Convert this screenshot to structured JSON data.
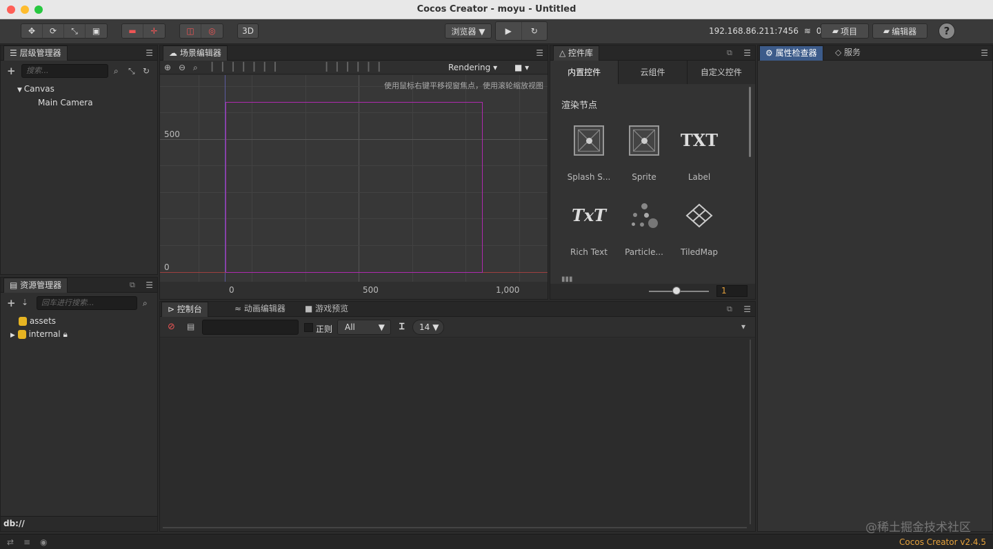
{
  "window": {
    "title": "Cocos Creator - moyu - Untitled"
  },
  "toolbar": {
    "transform_tools": [
      "✥",
      "⟳",
      "⤡",
      "▣"
    ],
    "mode_3d": "3D",
    "browser_select": "浏览器 ▼",
    "play": "▶",
    "refresh": "↻",
    "ip": "192.168.86.211:7456",
    "wifi_count": "0",
    "project_btn": "项目",
    "editor_btn": "编辑器",
    "help": "?"
  },
  "hierarchy": {
    "tab": "层级管理器",
    "search_placeholder": "搜索...",
    "nodes": [
      {
        "label": "Canvas"
      },
      {
        "label": "Main Camera"
      }
    ]
  },
  "assets": {
    "tab": "资源管理器",
    "search_placeholder": "回车进行搜索...",
    "items": [
      {
        "label": "assets"
      },
      {
        "label": "internal"
      }
    ],
    "footer": "db://"
  },
  "scene": {
    "tab": "场景编辑器",
    "rendering": "Rendering",
    "hint": "使用鼠标右键平移视窗焦点，使用滚轮缩放视图",
    "y_labels": [
      "500",
      "0"
    ],
    "x_labels": [
      "0",
      "500",
      "1,000"
    ]
  },
  "widgets": {
    "tab": "控件库",
    "subtabs": [
      "内置控件",
      "云组件",
      "自定义控件"
    ],
    "section": "渲染节点",
    "items": [
      {
        "label": "Splash S...",
        "icon": "splash-icon"
      },
      {
        "label": "Sprite",
        "icon": "sprite-icon"
      },
      {
        "label": "Label",
        "icon": "label-icon"
      },
      {
        "label": "Rich Text",
        "icon": "richtext-icon"
      },
      {
        "label": "Particle...",
        "icon": "particle-icon"
      },
      {
        "label": "TiledMap",
        "icon": "tiledmap-icon"
      }
    ],
    "label_glyph": "TXT",
    "richtext_glyph": "TxT",
    "zoom_value": "1"
  },
  "inspector": {
    "tab": "属性检查器",
    "service_tab": "服务"
  },
  "console": {
    "tabs": [
      "控制台",
      "动画编辑器",
      "游戏预览"
    ],
    "regex_label": "正则",
    "filter_select": "All",
    "font_size": "14"
  },
  "statusbar": {
    "version": "Cocos Creator v2.4.5",
    "watermark": "@稀土掘金技术社区"
  },
  "colors": {
    "accent": "#3c5b8a",
    "design_rect": "#b02ab0",
    "version": "#e6a23c"
  }
}
